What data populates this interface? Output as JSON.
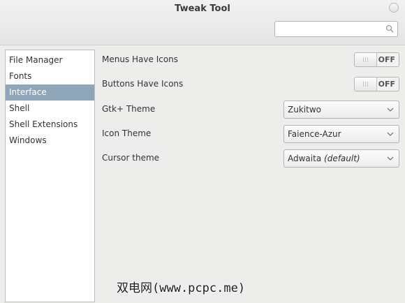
{
  "window": {
    "title": "Tweak Tool"
  },
  "search": {
    "placeholder": "",
    "value": ""
  },
  "sidebar": {
    "items": [
      {
        "label": "File Manager"
      },
      {
        "label": "Fonts"
      },
      {
        "label": "Interface",
        "selected": true
      },
      {
        "label": "Shell"
      },
      {
        "label": "Shell Extensions"
      },
      {
        "label": "Windows"
      }
    ]
  },
  "settings": {
    "menus_have_icons": {
      "label": "Menus Have Icons",
      "state": "OFF"
    },
    "buttons_have_icons": {
      "label": "Buttons Have Icons",
      "state": "OFF"
    },
    "gtk_theme": {
      "label": "Gtk+ Theme",
      "value": "Zukitwo"
    },
    "icon_theme": {
      "label": "Icon Theme",
      "value": "Faience-Azur"
    },
    "cursor_theme": {
      "label": "Cursor theme",
      "value": "Adwaita",
      "suffix": "(default)"
    }
  },
  "watermark": {
    "text": "双电网(www.pcpc.me)"
  },
  "icons": {
    "search": "search-icon",
    "close": "close-icon",
    "dropdown": "chevron-down-icon"
  },
  "colors": {
    "selection": "#8fa6b9",
    "window_bg": "#ededec"
  }
}
